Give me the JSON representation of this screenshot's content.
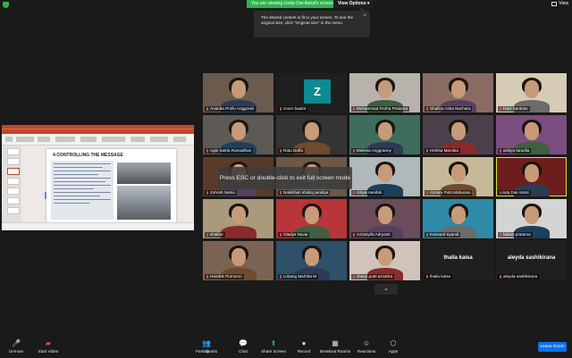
{
  "topbar": {
    "viewing_text": "You are viewing Linda Dwi Astuti's screen",
    "view_options": "View Options",
    "view_button": "View"
  },
  "tooltip": {
    "text": "The shared content is fit to your screen. To see the original size, click \"Original size\" in the menu."
  },
  "fullscreen_notice": "Press ESC or double-click to exit full screen mode",
  "participants": [
    {
      "name": "Ananda Prollo Anggraini",
      "bg": "#6b5a4e",
      "muted": true
    },
    {
      "name": "zoom baa04",
      "bg": "#1f1f1f",
      "avatar": "Z",
      "muted": true
    },
    {
      "name": "Muhammad Firzha Pratama",
      "bg": "#b7b2ac",
      "muted": true
    },
    {
      "name": "Shafina Azka Nachara",
      "bg": "#8a6b63",
      "muted": true
    },
    {
      "name": "Hani Santoso",
      "bg": "#d6ccb6",
      "muted": true
    },
    {
      "name": "Agie Satria Ramadhan",
      "bg": "#5d5a55",
      "muted": true
    },
    {
      "name": "Ratu Daffa",
      "bg": "#343434",
      "muted": true
    },
    {
      "name": "Melissa Anggraeny",
      "bg": "#3e6d5e",
      "muted": true
    },
    {
      "name": "Herlisa Marnika",
      "bg": "#4c3f4c",
      "muted": true
    },
    {
      "name": "azkiya faradila",
      "bg": "#7a4e7e",
      "muted": true
    },
    {
      "name": "Zohrah Satria",
      "bg": "#5a3b2b",
      "muted": true
    },
    {
      "name": "Naldirhan shidiq pandiya",
      "bg": "#6b5848",
      "muted": true
    },
    {
      "name": "Aziya Hanifah",
      "bg": "#b0b8ba",
      "muted": true
    },
    {
      "name": "Azzara Putri Maharani",
      "bg": "#c6b99a",
      "muted": true
    },
    {
      "name": "Linda Dwi Astuti",
      "bg": "#6e1d1d",
      "muted": false,
      "highlight": true
    },
    {
      "name": "shaline",
      "bg": "#a89a7a",
      "muted": true
    },
    {
      "name": "Gladys Navai",
      "bg": "#b8353a",
      "muted": true
    },
    {
      "name": "Azzasyifa Adryanti",
      "bg": "#6a4c5a",
      "muted": true
    },
    {
      "name": "Kamand Syandi",
      "bg": "#2e8aa8",
      "muted": true
    },
    {
      "name": "fabian pratama",
      "bg": "#d4d4d4",
      "muted": true
    },
    {
      "name": "Hendrik Purnomo",
      "bg": "#7a6352",
      "muted": true
    },
    {
      "name": "Lintang Marhfat M",
      "bg": "#2e5069",
      "muted": true
    },
    {
      "name": "cheryl putri azzahra",
      "bg": "#cfc3ba",
      "muted": true
    },
    {
      "name": "thalia kaisa",
      "bg": "#1f1f1f",
      "bigname": "thalia kaisa",
      "muted": true
    },
    {
      "name": "aleyda sashikirana",
      "bg": "#1f1f1f",
      "bigname": "aleyda sashikirana",
      "muted": true
    }
  ],
  "slide": {
    "title": "4-CONTROLLING THE MESSAGE"
  },
  "toolbar": {
    "unmute": "Unmute",
    "start_video": "Start Video",
    "participants": "Participants",
    "participants_count": "40",
    "chat": "Chat",
    "share_screen": "Share Screen",
    "record": "Record",
    "breakout": "Breakout Rooms",
    "reactions": "Reactions",
    "apps": "Apps",
    "leave": "Leave Room"
  },
  "colors": {
    "accent_green": "#2fb34d",
    "leave_blue": "#0e71eb",
    "highlight": "#d8e834"
  }
}
